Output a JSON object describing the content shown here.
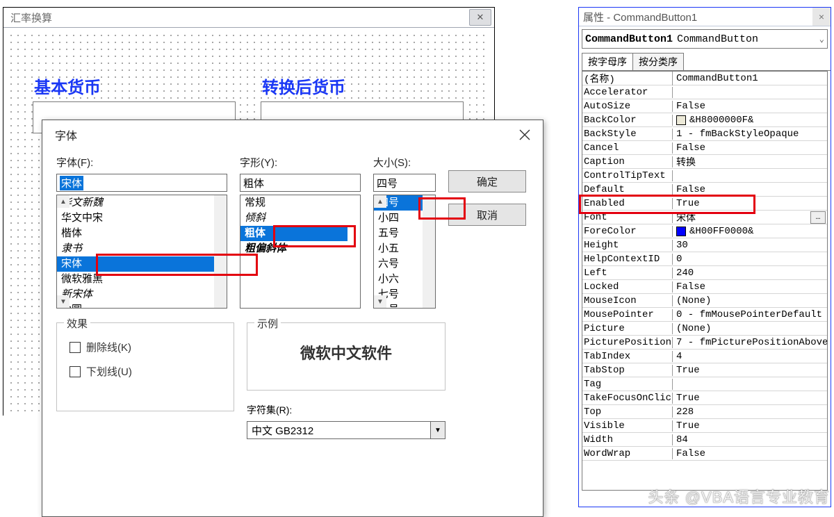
{
  "userform": {
    "title": "汇率换算",
    "label1": "基本货币",
    "label2": "转换后货币"
  },
  "dlg": {
    "title": "字体",
    "font_label": "字体(F):",
    "font_value": "宋体",
    "font_list": [
      "华文新魏",
      "华文中宋",
      "楷体",
      "隶书",
      "宋体",
      "微软雅黑",
      "新宋体",
      "幼圆"
    ],
    "font_hl_index": 4,
    "style_label": "字形(Y):",
    "style_value": "粗体",
    "style_list": [
      "常规",
      "倾斜",
      "粗体",
      "粗偏斜体"
    ],
    "style_hl_index": 2,
    "size_label": "大小(S):",
    "size_value": "四号",
    "size_list": [
      "四号",
      "小四",
      "五号",
      "小五",
      "六号",
      "小六",
      "七号",
      "八号"
    ],
    "size_hl_index": 0,
    "ok": "确定",
    "cancel": "取消",
    "effects": "效果",
    "strike": "删除线(K)",
    "underline": "下划线(U)",
    "sample_label": "示例",
    "sample_text": "微软中文软件",
    "charset_label": "字符集(R):",
    "charset_value": "中文 GB2312"
  },
  "props": {
    "title": "属性 - CommandButton1",
    "obj_name": "CommandButton1",
    "obj_type": "CommandButton",
    "tab_alpha": "按字母序",
    "tab_cat": "按分类序",
    "rows": [
      {
        "k": "(名称)",
        "v": "CommandButton1"
      },
      {
        "k": "Accelerator",
        "v": ""
      },
      {
        "k": "AutoSize",
        "v": "False"
      },
      {
        "k": "BackColor",
        "v": "&H8000000F&",
        "swatch": "#ece9d8"
      },
      {
        "k": "BackStyle",
        "v": "1 - fmBackStyleOpaque"
      },
      {
        "k": "Cancel",
        "v": "False"
      },
      {
        "k": "Caption",
        "v": "转换"
      },
      {
        "k": "ControlTipText",
        "v": ""
      },
      {
        "k": "Default",
        "v": "False"
      },
      {
        "k": "Enabled",
        "v": "True"
      },
      {
        "k": "Font",
        "v": "宋体",
        "ell": true
      },
      {
        "k": "ForeColor",
        "v": "&H00FF0000&",
        "swatch": "#0000ff"
      },
      {
        "k": "Height",
        "v": "30"
      },
      {
        "k": "HelpContextID",
        "v": "0"
      },
      {
        "k": "Left",
        "v": "240"
      },
      {
        "k": "Locked",
        "v": "False"
      },
      {
        "k": "MouseIcon",
        "v": "(None)"
      },
      {
        "k": "MousePointer",
        "v": "0 - fmMousePointerDefault"
      },
      {
        "k": "Picture",
        "v": "(None)"
      },
      {
        "k": "PicturePosition",
        "v": "7 - fmPicturePositionAboveCenter"
      },
      {
        "k": "TabIndex",
        "v": "4"
      },
      {
        "k": "TabStop",
        "v": "True"
      },
      {
        "k": "Tag",
        "v": ""
      },
      {
        "k": "TakeFocusOnClick",
        "v": "True"
      },
      {
        "k": "Top",
        "v": "228"
      },
      {
        "k": "Visible",
        "v": "True"
      },
      {
        "k": "Width",
        "v": "84"
      },
      {
        "k": "WordWrap",
        "v": "False"
      }
    ]
  },
  "watermark": "头条 @VBA语言专业教育"
}
